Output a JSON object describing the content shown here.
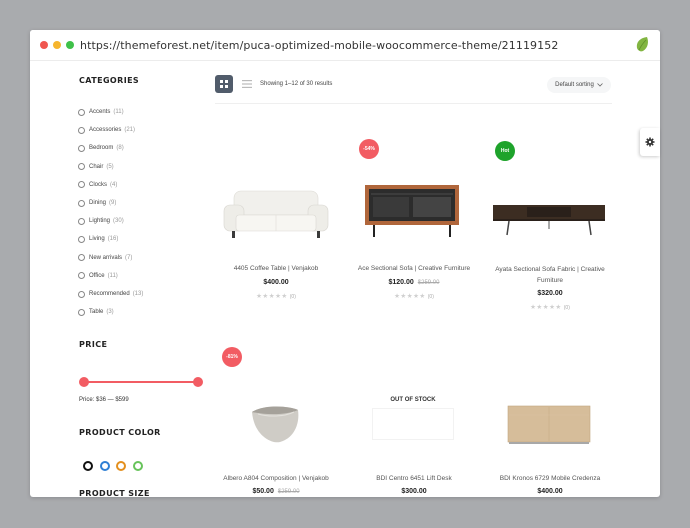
{
  "browser": {
    "url": "https://themeforest.net/item/puca-optimized-mobile-woocommerce-theme/21119152"
  },
  "sidebar": {
    "categories_title": "CATEGORIES",
    "categories": [
      {
        "name": "Accents",
        "count": "(11)"
      },
      {
        "name": "Accessories",
        "count": "(21)"
      },
      {
        "name": "Bedroom",
        "count": "(8)"
      },
      {
        "name": "Chair",
        "count": "(5)"
      },
      {
        "name": "Clocks",
        "count": "(4)"
      },
      {
        "name": "Dining",
        "count": "(9)"
      },
      {
        "name": "Lighting",
        "count": "(30)"
      },
      {
        "name": "Living",
        "count": "(16)"
      },
      {
        "name": "New arrivals",
        "count": "(7)"
      },
      {
        "name": "Office",
        "count": "(11)"
      },
      {
        "name": "Recommended",
        "count": "(13)"
      },
      {
        "name": "Table",
        "count": "(3)"
      }
    ],
    "price_title": "PRICE",
    "price_range": {
      "min": 36,
      "max": 599
    },
    "price_text": "Price: $36 — $599",
    "color_title": "PRODUCT COLOR",
    "colors": [
      "#111111",
      "#2f7fd4",
      "#e38f1e",
      "#67c35a"
    ],
    "size_title": "PRODUCT SIZE"
  },
  "toolbar": {
    "grid_icon": "grid-icon",
    "list_icon": "list-icon",
    "results_text": "Showing 1–12 of 30 results",
    "sort_label": "Default sorting"
  },
  "settings": {
    "icon": "gear-icon"
  },
  "products": [
    {
      "title": "4405 Coffee Table | Venjakob",
      "price": "$400.00",
      "old_price": "",
      "badge": "",
      "reviews": "(0)",
      "rating": 0
    },
    {
      "title": "Ace Sectional Sofa | Creative Furniture",
      "price": "$120.00",
      "old_price": "$259.00",
      "badge": "-54%",
      "reviews": "(0)",
      "rating": 0
    },
    {
      "title": "Ayata Sectional Sofa Fabric | Creative Furniture",
      "price": "$320.00",
      "old_price": "",
      "badge": "Hot",
      "reviews": "(0)",
      "rating": 0
    },
    {
      "title": "Albero A804 Composition | Venjakob",
      "price": "$50.00",
      "old_price": "$259.00",
      "badge": "-81%",
      "reviews": "",
      "rating": 0
    },
    {
      "title": "BDI Centro 6451 Lift Desk",
      "price": "$300.00",
      "old_price": "",
      "badge": "",
      "status": "OUT OF STOCK",
      "reviews": "",
      "rating": 0
    },
    {
      "title": "BDI Kronos 6729 Mobile Credenza",
      "price": "$400.00",
      "old_price": "",
      "badge": "",
      "reviews": "",
      "rating": 0
    }
  ],
  "colors": {
    "accent": "#f25c63",
    "hot": "#1ea32b",
    "grid_active": "#515c6b"
  }
}
